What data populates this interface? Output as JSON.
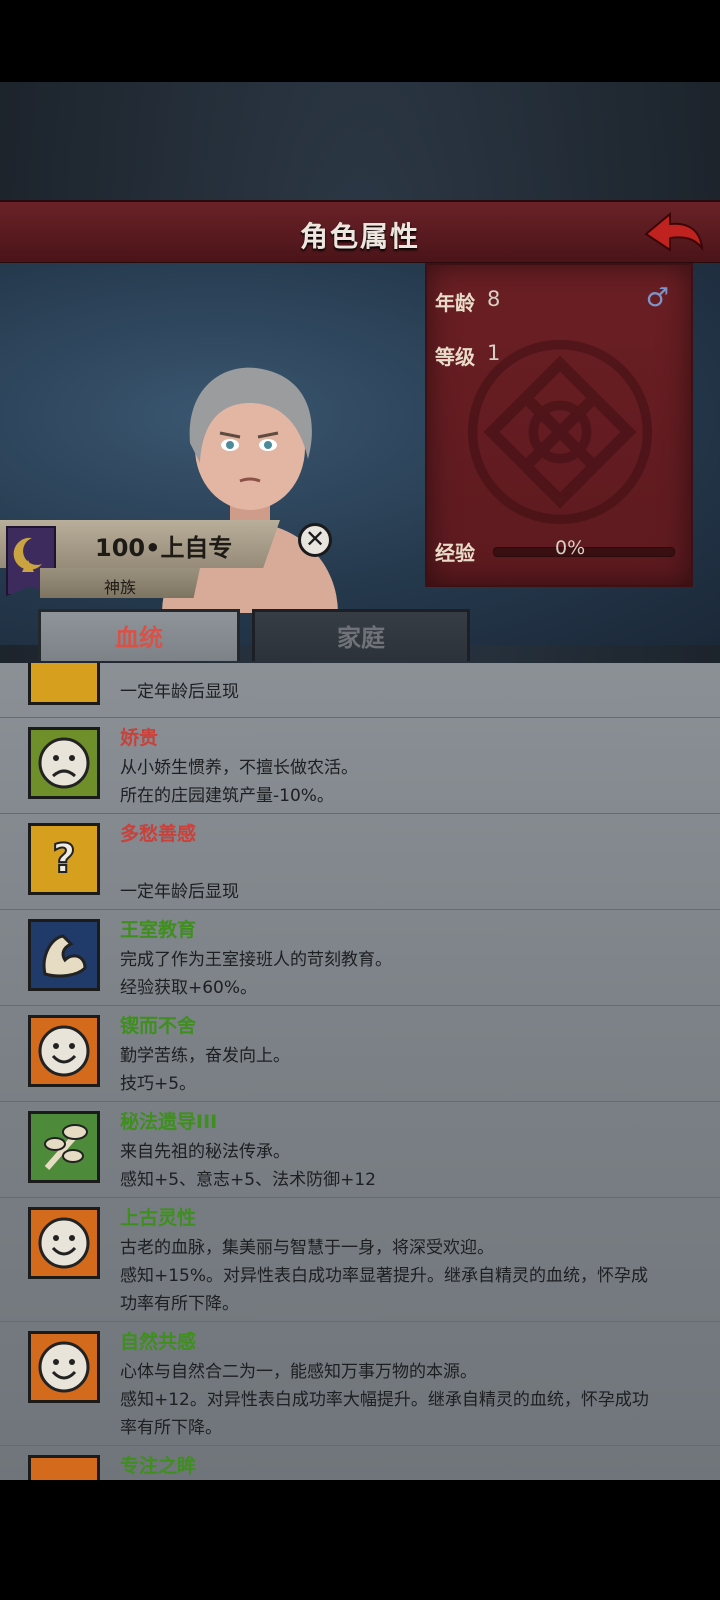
{
  "header": {
    "title": "角色属性"
  },
  "stats": {
    "age_label": "年龄",
    "age_value": "8",
    "level_label": "等级",
    "level_value": "1",
    "exp_label": "经验",
    "exp_value": "0%",
    "exp_fraction": 0,
    "gender_icon": "male-symbol-icon",
    "gender_glyph": "♂"
  },
  "character": {
    "name": "100•上自专",
    "race": "神族"
  },
  "tabs": {
    "bloodline": "血统",
    "family": "家庭"
  },
  "traits": [
    {
      "name": "",
      "lines": [
        "一定年龄后显现"
      ],
      "color": "gold",
      "icon": "question-mark-icon"
    },
    {
      "name": "娇贵",
      "lines": [
        "从小娇生惯养，不擅长做农活。",
        "所在的庄园建筑产量-10%。"
      ],
      "color": "red",
      "icon": "sad-face-icon"
    },
    {
      "name": "多愁善感",
      "lines": [
        "",
        "一定年龄后显现"
      ],
      "color": "red",
      "icon": "question-mark-icon"
    },
    {
      "name": "王室教育",
      "lines": [
        "完成了作为王室接班人的苛刻教育。",
        "经验获取+60%。"
      ],
      "color": "green",
      "icon": "flexed-arm-icon"
    },
    {
      "name": "锲而不舍",
      "lines": [
        "勤学苦练，奋发向上。",
        "技巧+5。"
      ],
      "color": "green",
      "icon": "smiley-face-icon"
    },
    {
      "name": "秘法遗导III",
      "lines": [
        "来自先祖的秘法传承。",
        "感知+5、意志+5、法术防御+12"
      ],
      "color": "green",
      "icon": "leaf-branch-icon"
    },
    {
      "name": "上古灵性",
      "lines": [
        "古老的血脉，集美丽与智慧于一身，将深受欢迎。",
        "感知+15%。对异性表白成功率显著提升。继承自精灵的血统，怀孕成",
        "功率有所下降。"
      ],
      "color": "green",
      "icon": "smiley-face-icon"
    },
    {
      "name": "自然共感",
      "lines": [
        "心体与自然合二为一，能感知万事万物的本源。",
        "感知+12。对异性表白成功率大幅提升。继承自精灵的血统，怀孕成功",
        "率有所下降。"
      ],
      "color": "green",
      "icon": "smiley-face-icon"
    },
    {
      "name": "专注之眸",
      "lines": [],
      "color": "green",
      "icon": "smiley-face-icon"
    }
  ]
}
